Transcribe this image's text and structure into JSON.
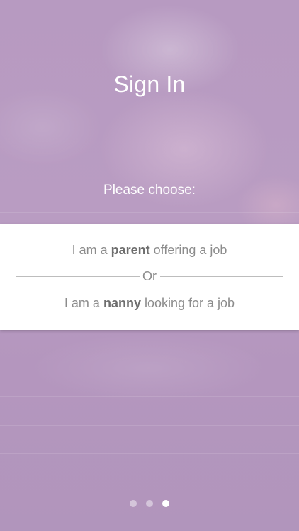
{
  "screen": {
    "title": "Sign In",
    "prompt": "Please choose:"
  },
  "options": {
    "parent": {
      "prefix": "I am a ",
      "role": "parent",
      "suffix": " offering a job"
    },
    "separator": "Or",
    "nanny": {
      "prefix": "I am a ",
      "role": "nanny",
      "suffix": " looking for a job"
    }
  },
  "pagination": {
    "total_pages": 3,
    "active_page": 3
  },
  "colors": {
    "overlay": "#b497bd",
    "panel": "#ffffff",
    "option_text": "#8c8c8c",
    "option_bold": "#6e6e6e"
  }
}
